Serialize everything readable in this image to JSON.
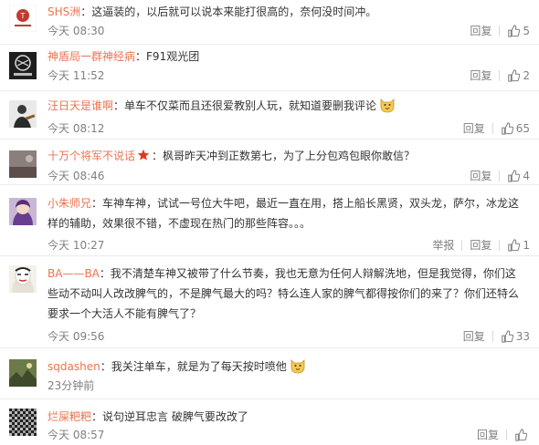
{
  "labels": {
    "reply": "回复",
    "report": "举报"
  },
  "comments": [
    {
      "user": "SHS洲",
      "text": "这逼装的，以后就可以说本来能打很高的，奈何没时间冲。",
      "time": "今天 08:30",
      "likes": "5"
    },
    {
      "user": "神盾局一群神经病",
      "text": "F91观光团",
      "time": "今天 11:52",
      "likes": "2"
    },
    {
      "user": "汪日天是谁啊",
      "text": "单车不仅菜而且还很爱教别人玩，就知道要删我评论",
      "time": "今天 08:12",
      "likes": "65"
    },
    {
      "user": "十万个将军不说话",
      "text": "枫哥昨天冲到正数第七，为了上分包鸡包眼你敢信？",
      "time": "今天 08:46",
      "likes": "4"
    },
    {
      "user": "小朱师兄",
      "text": "车神车神，试试一号位大牛吧，最近一直在用，搭上船长黑贤，双头龙，萨尔，冰龙这样的辅助，效果很不错，不虚现在热门的那些阵容。。。",
      "time": "今天 10:27",
      "likes": "1"
    },
    {
      "user": "BA——BA",
      "text": "我不清楚车神又被带了什么节奏，我也无意为任何人辩解洗地，但是我觉得，你们这些动不动叫人改改脾气的，不是脾气最大的吗？特么连人家的脾气都得按你们的来了？你们还特么要求一个大活人不能有脾气了？",
      "time": "今天 09:56",
      "likes": "33"
    },
    {
      "user": "sqdashen",
      "text": "我关注单车，就是为了每天按时喷他",
      "time": "23分钟前",
      "likes": ""
    },
    {
      "user": "烂屎粑粑",
      "text": "说句逆耳忠言 破脾气要改改了",
      "time": "今天 08:57",
      "likes": ""
    }
  ]
}
